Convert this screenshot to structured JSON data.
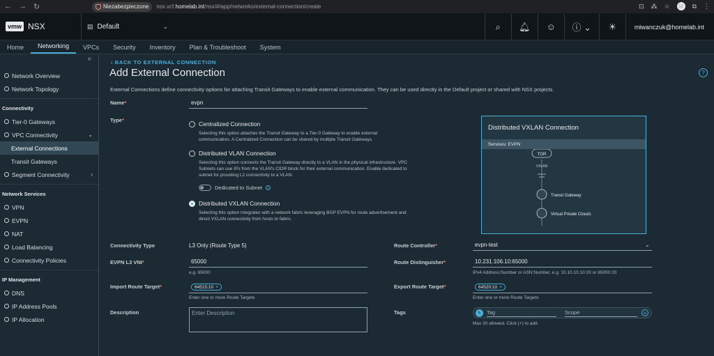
{
  "browser": {
    "security_label": "Niezabezpieczone",
    "url_prefix": "nsx.vcf.",
    "url_domain": "homelab.int",
    "url_path": "/nsx/#/app/networks/external-connection/create",
    "profile_initial": "M"
  },
  "header": {
    "brand_logo": "vmw",
    "product": "NSX",
    "project": "Default",
    "user": "miwanczuk@homelab.int"
  },
  "tabs": [
    {
      "label": "Home"
    },
    {
      "label": "Networking",
      "active": true
    },
    {
      "label": "VPCs"
    },
    {
      "label": "Security"
    },
    {
      "label": "Inventory"
    },
    {
      "label": "Plan & Troubleshoot"
    },
    {
      "label": "System"
    }
  ],
  "sidebar": {
    "collapse": "«",
    "items": [
      {
        "label": "Network Overview"
      },
      {
        "label": "Network Topology"
      },
      {
        "label": "Connectivity",
        "heading": true
      },
      {
        "label": "Tier-0 Gateways"
      },
      {
        "label": "VPC Connectivity"
      },
      {
        "label": "External Connections"
      },
      {
        "label": "Transit Gateways"
      },
      {
        "label": "Segment Connectivity"
      },
      {
        "label": "Network Services",
        "heading": true
      },
      {
        "label": "VPN"
      },
      {
        "label": "EVPN"
      },
      {
        "label": "NAT"
      },
      {
        "label": "Load Balancing"
      },
      {
        "label": "Connectivity Policies"
      },
      {
        "label": "IP Management",
        "heading": true
      },
      {
        "label": "DNS"
      },
      {
        "label": "IP Address Pools"
      },
      {
        "label": "IP Allocation"
      }
    ]
  },
  "page": {
    "back_link": "BACK TO EXTERNAL CONNECTION",
    "title": "Add External Connection",
    "description": "External Connections define connectivity options for attaching Transit Gateways to enable external communication. They can be used directly in the Default project or shared with NSX projects."
  },
  "form": {
    "name_label": "Name",
    "name_value": "evpn",
    "type_label": "Type",
    "type_options": [
      {
        "label": "Centralized Connection",
        "desc": "Selecting this option attaches the Transit Gateway to a Tier-0 Gateway to enable external communication. A Centralized Connection can be shared by multiple Transit Gateways.",
        "selected": false
      },
      {
        "label": "Distributed VLAN Connection",
        "desc": "Selecting this option connects the Transit Gateway directly to a VLAN in the physical infrastructure. VPC Subnets can use IPs from the VLAN's CIDR block for their external communication. Enable dedicated to subnet for providing L2 connectivity to a VLAN.",
        "selected": false
      },
      {
        "label": "Distributed VXLAN Connection",
        "desc": "Selecting this option integrates with a network fabric leveraging BGP EVPN for route advertisement and direct VXLAN connectivity from hosts to fabric.",
        "selected": true
      }
    ],
    "dedicated_label": "Dedicated to Subnet",
    "connectivity_type_label": "Connectivity Type",
    "connectivity_type_value": "L3 Only (Route Type 5)",
    "route_controller_label": "Route Controller",
    "route_controller_value": "evpn-test",
    "vni_label": "EVPN L3 VNI",
    "vni_value": "65000",
    "vni_hint": "e.g. 65000",
    "rd_label": "Route Distinguisher",
    "rd_value": "10.231.106.10:65000",
    "rd_hint": "IPv4 Address:Number or ASN:Number, e.g. 10.10.10.10:20 or 65000:20",
    "import_label": "Import Route Target",
    "import_chip": "64515:10",
    "import_hint": "Enter one or more Route Targets",
    "export_label": "Export Route Target",
    "export_chip": "64520:10",
    "export_hint": "Enter one or more Route Targets",
    "description_label": "Description",
    "description_placeholder": "Enter Description",
    "tags_label": "Tags",
    "tag_placeholder": "Tag",
    "scope_placeholder": "Scope",
    "tags_hint": "Max 30 allowed. Click (+) to add."
  },
  "diagram": {
    "title": "Distributed VXLAN Connection",
    "services": "Services: EVPN",
    "tor": "TOR",
    "vxlan": "VXLAN",
    "transit_gateway": "Transit Gateway",
    "vpc": "Virtual Private Clouds"
  },
  "colors": {
    "accent": "#49afd9",
    "required": "#f27963",
    "background": "#1b2a33"
  }
}
